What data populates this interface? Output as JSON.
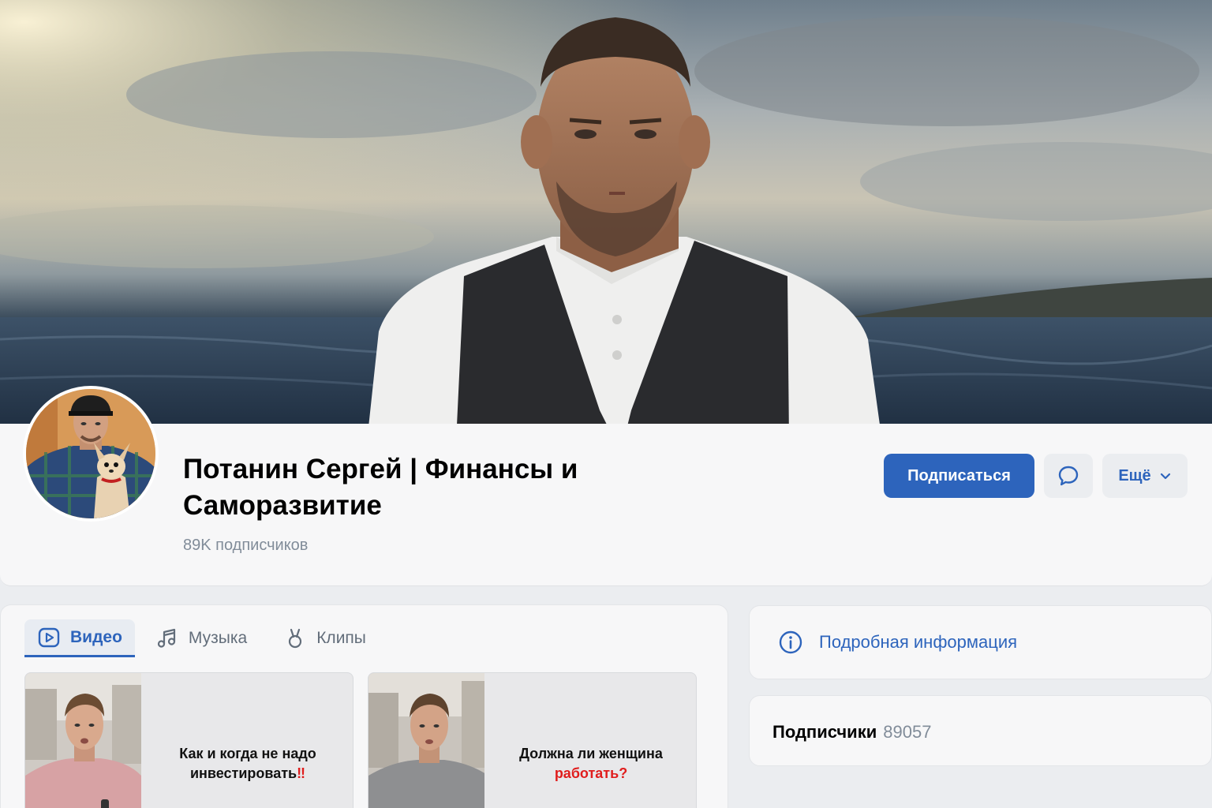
{
  "profile": {
    "name": "Потанин Сергей | Финансы и Саморазвитие",
    "followers_text": "89K подписчиков"
  },
  "actions": {
    "subscribe_label": "Подписаться",
    "message_icon": "message-bubble-icon",
    "more_label": "Ещё",
    "more_icon": "chevron-down-icon"
  },
  "tabs": [
    {
      "label": "Видео",
      "icon": "video-play-icon",
      "active": true
    },
    {
      "label": "Музыка",
      "icon": "music-note-icon",
      "active": false
    },
    {
      "label": "Клипы",
      "icon": "clips-icon",
      "active": false
    }
  ],
  "videos": [
    {
      "line1": "Как и когда не надо",
      "line2": "инвестировать",
      "accent": "‼"
    },
    {
      "line1": "Должна ли женщина",
      "line2": "работать?",
      "accent": ""
    }
  ],
  "sidebar": {
    "info_label": "Подробная информация",
    "info_icon": "info-circle-icon",
    "subscribers_label": "Подписчики",
    "subscribers_count": "89057"
  },
  "colors": {
    "accent": "#2d64bc",
    "background": "#ebedf0",
    "card": "#f7f7f8",
    "muted_text": "#818c99",
    "red_accent": "#e01d1d"
  }
}
